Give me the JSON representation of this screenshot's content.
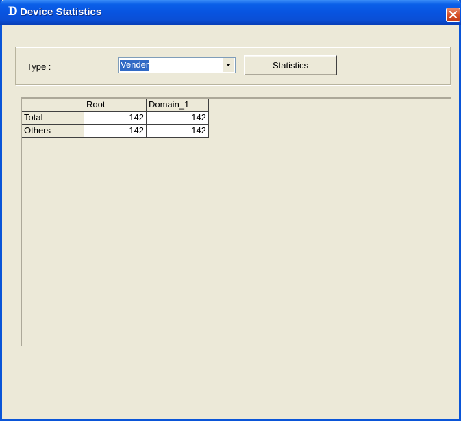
{
  "window": {
    "logo": "D",
    "title": "Device Statistics"
  },
  "form": {
    "type_label": "Type :",
    "type_value": "Vender",
    "statistics_button": "Statistics"
  },
  "table": {
    "columns": [
      "",
      "Root",
      "Domain_1"
    ],
    "rows": [
      {
        "label": "Total",
        "root": "142",
        "domain_1": "142"
      },
      {
        "label": "Others",
        "root": "142",
        "domain_1": "142"
      }
    ]
  },
  "icons": {
    "close": "close-icon",
    "dropdown": "chevron-down-icon"
  },
  "colors": {
    "titlebar": "#0a55d8",
    "window_bg": "#ece9d8",
    "close": "#d8522a",
    "selection": "#316ac5"
  }
}
